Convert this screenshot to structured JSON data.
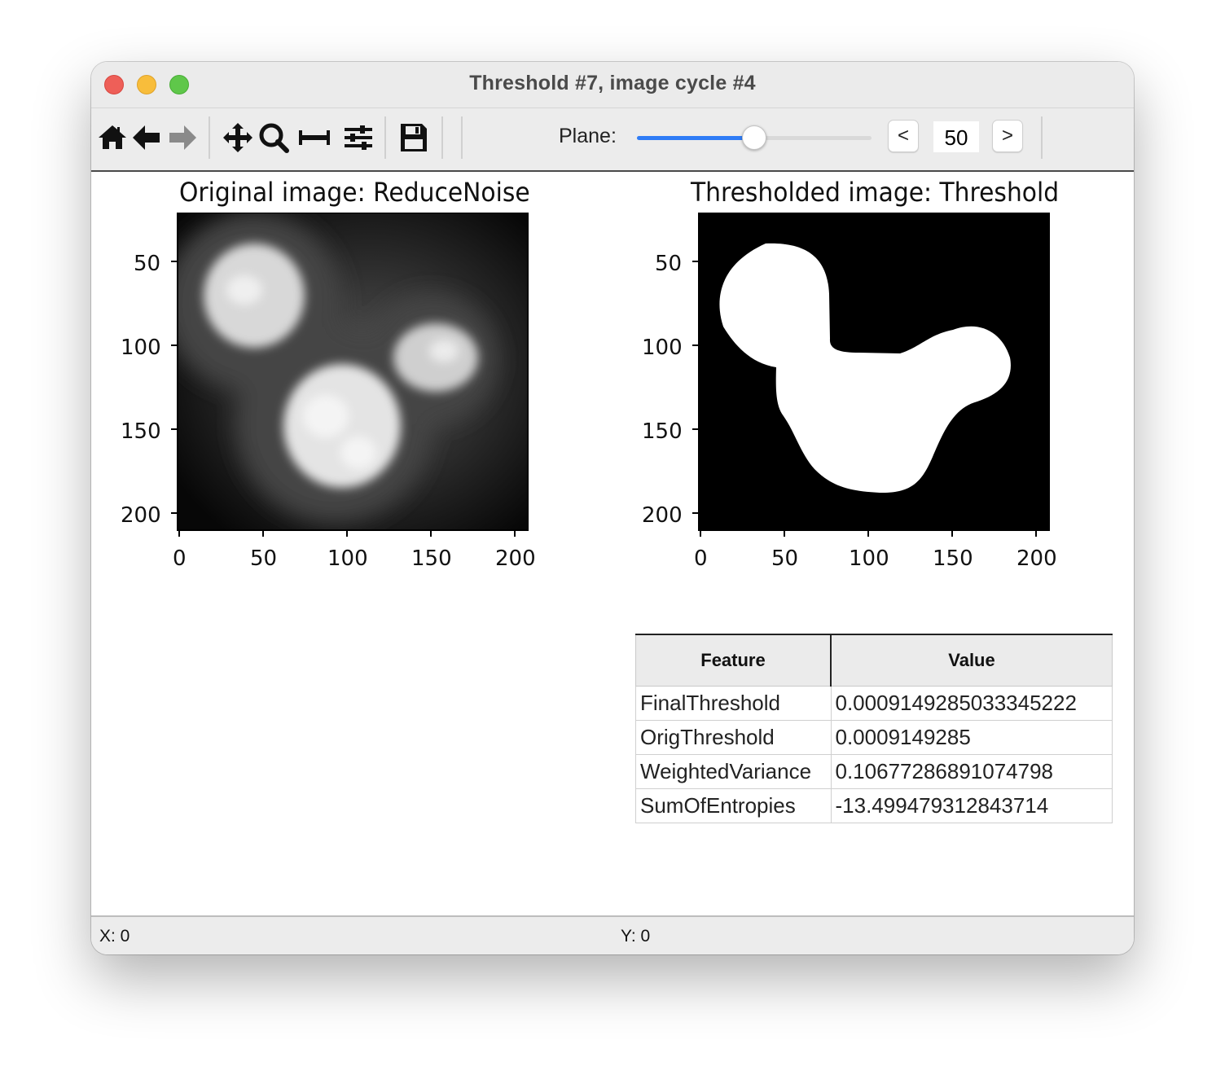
{
  "window": {
    "title": "Threshold #7, image cycle #4"
  },
  "toolbar": {
    "tools": [
      "home-icon",
      "back-arrow-icon",
      "forward-arrow-icon",
      "pan-icon",
      "zoom-icon",
      "subplots-icon",
      "configure-icon",
      "save-icon"
    ],
    "plane_label": "Plane:",
    "plane_value": "50",
    "plane_slider_fraction": 0.5,
    "prev_label": "<",
    "next_label": ">",
    "slider_color": "#2f7cf6"
  },
  "plots": {
    "original": {
      "title": "Original image: ReduceNoise",
      "y_ticks": [
        "50",
        "100",
        "150",
        "200"
      ],
      "x_ticks": [
        "0",
        "50",
        "100",
        "150",
        "200"
      ],
      "colormap": "gray"
    },
    "thresholded": {
      "title": "Thresholded image: Threshold",
      "y_ticks": [
        "50",
        "100",
        "150",
        "200"
      ],
      "x_ticks": [
        "0",
        "50",
        "100",
        "150",
        "200"
      ],
      "colormap": "binary"
    }
  },
  "table": {
    "headers": [
      "Feature",
      "Value"
    ],
    "rows": [
      [
        "FinalThreshold",
        "0.0009149285033345222"
      ],
      [
        "OrigThreshold",
        "0.0009149285"
      ],
      [
        "WeightedVariance",
        "0.10677286891074798"
      ],
      [
        "SumOfEntropies",
        "-13.499479312843714"
      ]
    ]
  },
  "status": {
    "x": "X: 0",
    "y": "Y: 0"
  }
}
